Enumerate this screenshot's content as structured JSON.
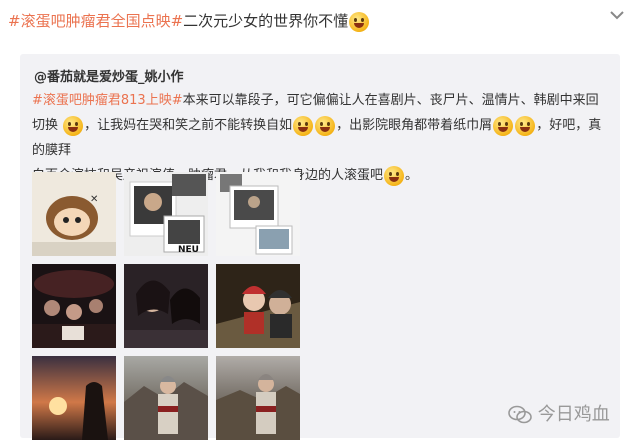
{
  "post": {
    "tag": "#滚蛋吧肿瘤君全国点映#",
    "text": "二次元少女的世界你不懂"
  },
  "repost": {
    "author": "@番茄就是爱炒蛋_姚小作",
    "tag": "#滚蛋吧肿瘤君813上映#",
    "text1": "本来可以靠段子，可它偏偏让人在喜剧片、丧尸片、温情片、韩剧中来回切换",
    "text2": "，让我妈在哭和笑之前不能转换自如",
    "text3": "，出影院眼角都带着纸巾屑",
    "text4": "，好吧，真的膜拜",
    "text5": "白百合演技和吴彦祖演值，肿瘤君，从我和我身边的人滚蛋吧",
    "text6": "。"
  },
  "watermark": "今日鸡血",
  "colors": {
    "tag": "#eb7350",
    "panel": "#f2f2f5"
  },
  "icons": [
    "chevron-down-icon",
    "emoji-icon",
    "wechat-icon"
  ],
  "photos": [
    "anime-cartoon-photo",
    "collage-photo",
    "polaroid-photo",
    "cinema-crowd-photo",
    "selfie-photo",
    "night-couple-photo",
    "sunset-photo",
    "mountain-girl-photo",
    "mountain-girl-photo-2"
  ]
}
